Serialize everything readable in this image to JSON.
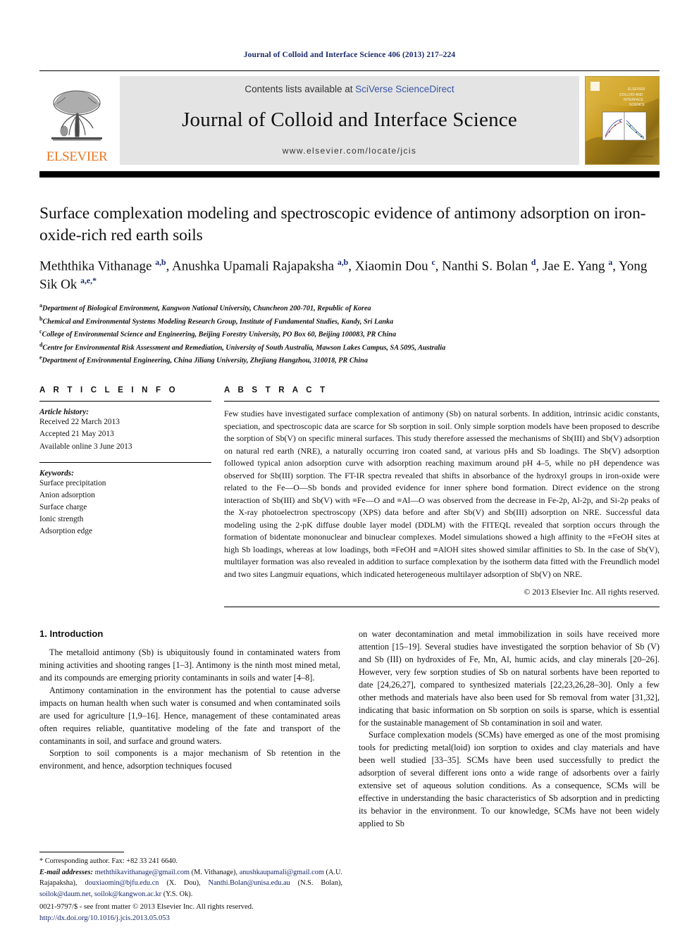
{
  "running_head": "Journal of Colloid and Interface Science 406 (2013) 217–224",
  "masthead": {
    "publisher_name": "ELSEVIER",
    "contents_prefix": "Contents lists available at ",
    "contents_link": "SciVerse ScienceDirect",
    "journal_title": "Journal of Colloid and Interface Science",
    "journal_url": "www.elsevier.com/locate/jcis",
    "cover_title_line1": "COLLOID AND",
    "cover_title_line2": "INTERFACE",
    "cover_title_line3": "SCIENCE"
  },
  "article": {
    "title": "Surface complexation modeling and spectroscopic evidence of antimony adsorption on iron-oxide-rich red earth soils",
    "authors_html": "Meththika Vithanage <sup>a,b</sup>, Anushka Upamali Rajapaksha <sup>a,b</sup>, Xiaomin Dou <sup>c</sup>, Nanthi S. Bolan <sup>d</sup>, Jae E. Yang <sup>a</sup>, Yong Sik Ok <sup>a,e,</sup><sup>*</sup>",
    "affiliations": [
      {
        "marker": "a",
        "text": "Department of Biological Environment, Kangwon National University, Chuncheon 200-701, Republic of Korea"
      },
      {
        "marker": "b",
        "text": "Chemical and Environmental Systems Modeling Research Group, Institute of Fundamental Studies, Kandy, Sri Lanka"
      },
      {
        "marker": "c",
        "text": "College of Environmental Science and Engineering, Beijing Forestry University, PO Box 60, Beijing 100083, PR China"
      },
      {
        "marker": "d",
        "text": "Centre for Environmental Risk Assessment and Remediation, University of South Australia, Mawson Lakes Campus, SA 5095, Australia"
      },
      {
        "marker": "e",
        "text": "Department of Environmental Engineering, China Jiliang University, Zhejiang Hangzhou, 310018, PR China"
      }
    ]
  },
  "article_info": {
    "heading": "A R T I C L E   I N F O",
    "history_label": "Article history:",
    "history": [
      "Received 22 March 2013",
      "Accepted 21 May 2013",
      "Available online 3 June 2013"
    ],
    "keywords_label": "Keywords:",
    "keywords": [
      "Surface precipitation",
      "Anion adsorption",
      "Surface charge",
      "Ionic strength",
      "Adsorption edge"
    ]
  },
  "abstract": {
    "heading": "A B S T R A C T",
    "text": "Few studies have investigated surface complexation of antimony (Sb) on natural sorbents. In addition, intrinsic acidic constants, speciation, and spectroscopic data are scarce for Sb sorption in soil. Only simple sorption models have been proposed to describe the sorption of Sb(V) on specific mineral surfaces. This study therefore assessed the mechanisms of Sb(III) and Sb(V) adsorption on natural red earth (NRE), a naturally occurring iron coated sand, at various pHs and Sb loadings. The Sb(V) adsorption followed typical anion adsorption curve with adsorption reaching maximum around pH 4–5, while no pH dependence was observed for Sb(III) sorption. The FT-IR spectra revealed that shifts in absorbance of the hydroxyl groups in iron-oxide were related to the Fe—O—Sb bonds and provided evidence for inner sphere bond formation. Direct evidence on the strong interaction of Sb(III) and Sb(V) with ≡Fe—O and ≡Al—O was observed from the decrease in Fe-2p, Al-2p, and Si-2p peaks of the X-ray photoelectron spectroscopy (XPS) data before and after Sb(V) and Sb(III) adsorption on NRE. Successful data modeling using the 2-pK diffuse double layer model (DDLM) with the FITEQL revealed that sorption occurs through the formation of bidentate mononuclear and binuclear complexes. Model simulations showed a high affinity to the ≡FeOH sites at high Sb loadings, whereas at low loadings, both ≡FeOH and ≡AlOH sites showed similar affinities to Sb. In the case of Sb(V), multilayer formation was also revealed in addition to surface complexation by the isotherm data fitted with the Freundlich model and two sites Langmuir equations, which indicated heterogeneous multilayer adsorption of Sb(V) on NRE.",
    "copyright": "© 2013 Elsevier Inc. All rights reserved."
  },
  "body": {
    "section_heading": "1. Introduction",
    "left_paragraphs": [
      "The metalloid antimony (Sb) is ubiquitously found in contaminated waters from mining activities and shooting ranges [1–3]. Antimony is the ninth most mined metal, and its compounds are emerging priority contaminants in soils and water [4–8].",
      "Antimony contamination in the environment has the potential to cause adverse impacts on human health when such water is consumed and when contaminated soils are used for agriculture [1,9–16]. Hence, management of these contaminated areas often requires reliable, quantitative modeling of the fate and transport of the contaminants in soil, and surface and ground waters.",
      "Sorption to soil components is a major mechanism of Sb retention in the environment, and hence, adsorption techniques focused"
    ],
    "right_paragraphs": [
      "on water decontamination and metal immobilization in soils have received more attention [15–19]. Several studies have investigated the sorption behavior of Sb (V) and Sb (III) on hydroxides of Fe, Mn, Al, humic acids, and clay minerals [20–26]. However, very few sorption studies of Sb on natural sorbents have been reported to date [24,26,27], compared to synthesized materials [22,23,26,28–30]. Only a few other methods and materials have also been used for Sb removal from water [31,32], indicating that basic information on Sb sorption on soils is sparse, which is essential for the sustainable management of Sb contamination in soil and water.",
      "Surface complexation models (SCMs) have emerged as one of the most promising tools for predicting metal(loid) ion sorption to oxides and clay materials and have been well studied [33–35]. SCMs have been used successfully to predict the adsorption of several different ions onto a wide range of adsorbents over a fairly extensive set of aqueous solution conditions. As a consequence, SCMs will be effective in understanding the basic characteristics of Sb adsorption and in predicting its behavior in the environment. To our knowledge, SCMs have not been widely applied to Sb"
    ]
  },
  "footnotes": {
    "corresponding": "* Corresponding author. Fax: +82 33 241 6640.",
    "email_label": "E-mail addresses:",
    "emails_html": " <span class=\"lnk\">meththikavithanage@gmail.com</span> (M. Vithanage), <span class=\"lnk\">anushkaupamali@gmail.com</span> (A.U. Rajapaksha), <span class=\"lnk\">douxiaomin@bjfu.edu.cn</span> (X. Dou), <span class=\"lnk\">Nanthi.Bolan@unisa.edu.au</span> (N.S. Bolan), <span class=\"lnk\">soilok@daum.net</span>, <span class=\"lnk\">soilok@kangwon.ac.kr</span> (Y.S. Ok)."
  },
  "issn": {
    "line1": "0021-9797/$ - see front matter © 2013 Elsevier Inc. All rights reserved.",
    "doi": "http://dx.doi.org/10.1016/j.jcis.2013.05.053"
  },
  "colors": {
    "link_blue": "#1a2a6b",
    "sciencedirect_blue": "#3a57a8",
    "elsevier_orange": "#E87722",
    "masthead_grey": "#e4e4e4",
    "cover_gold": "#caa02c"
  }
}
